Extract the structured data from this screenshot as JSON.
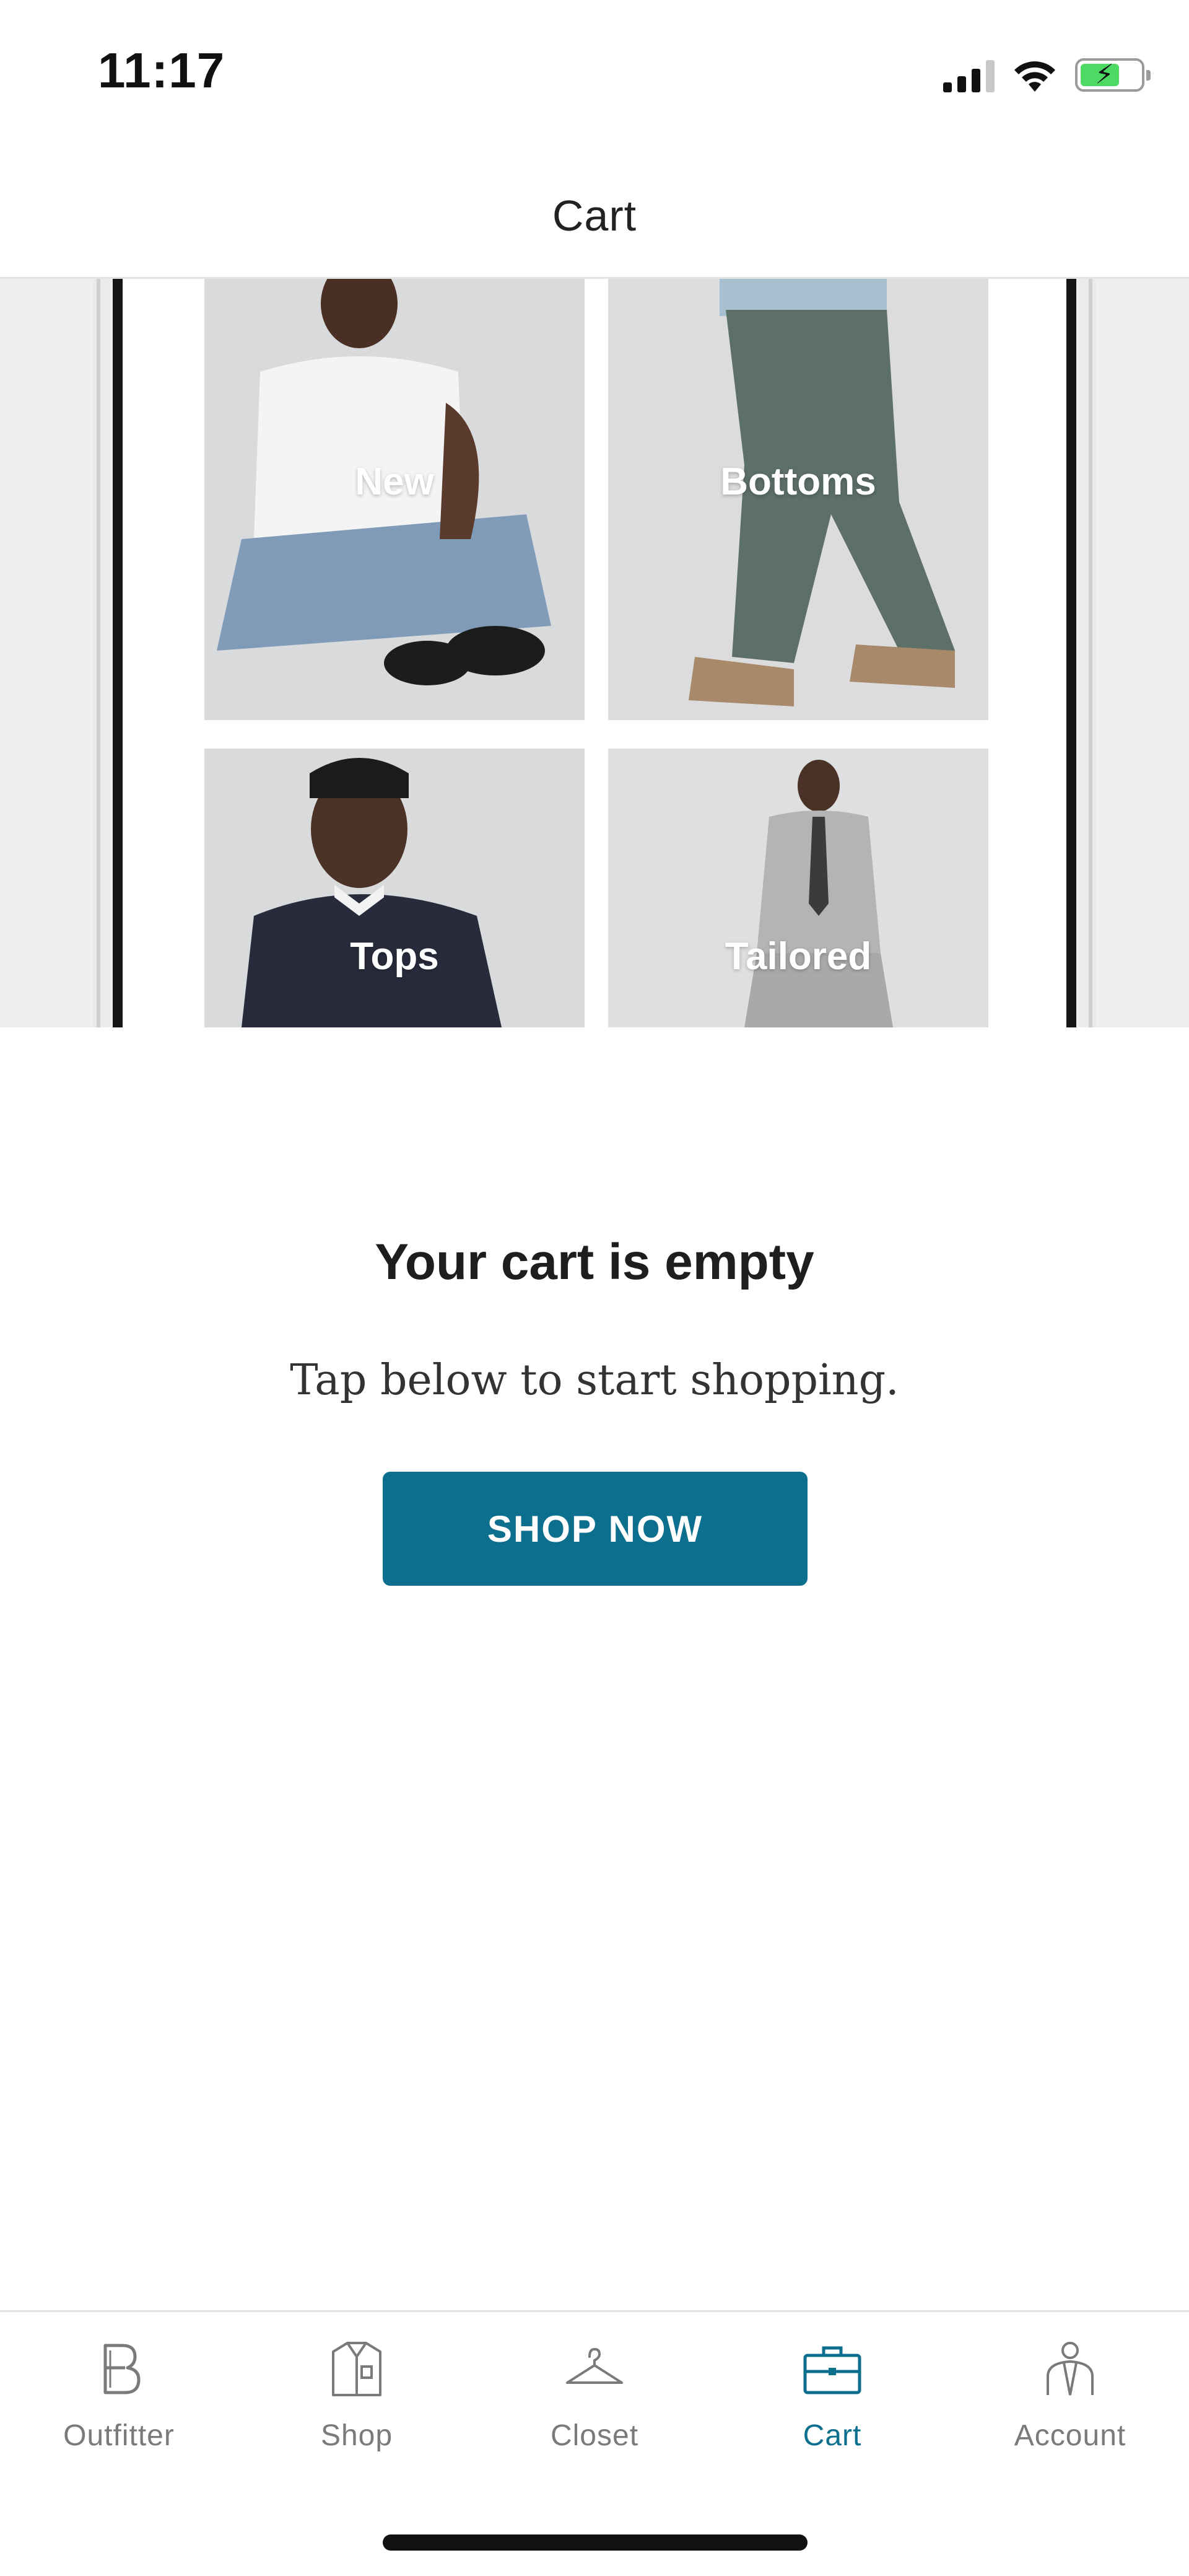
{
  "status_bar": {
    "time": "11:17",
    "icons": [
      "signal-icon",
      "wifi-icon",
      "battery-charging-icon"
    ]
  },
  "header": {
    "title": "Cart"
  },
  "hero": {
    "tiles": [
      {
        "label": "New"
      },
      {
        "label": "Bottoms"
      },
      {
        "label": "Tops"
      },
      {
        "label": "Tailored"
      }
    ]
  },
  "empty_state": {
    "title": "Your cart is empty",
    "subtitle": "Tap below to start shopping.",
    "button_label": "SHOP NOW"
  },
  "tab_bar": {
    "accent": "#0c6f8d",
    "inactive": "#7a7a7a",
    "active_tab": "Cart",
    "tabs": [
      {
        "label": "Outfitter",
        "icon": "outfitter-b-icon"
      },
      {
        "label": "Shop",
        "icon": "shirt-icon"
      },
      {
        "label": "Closet",
        "icon": "hanger-icon"
      },
      {
        "label": "Cart",
        "icon": "briefcase-icon"
      },
      {
        "label": "Account",
        "icon": "person-icon"
      }
    ]
  }
}
